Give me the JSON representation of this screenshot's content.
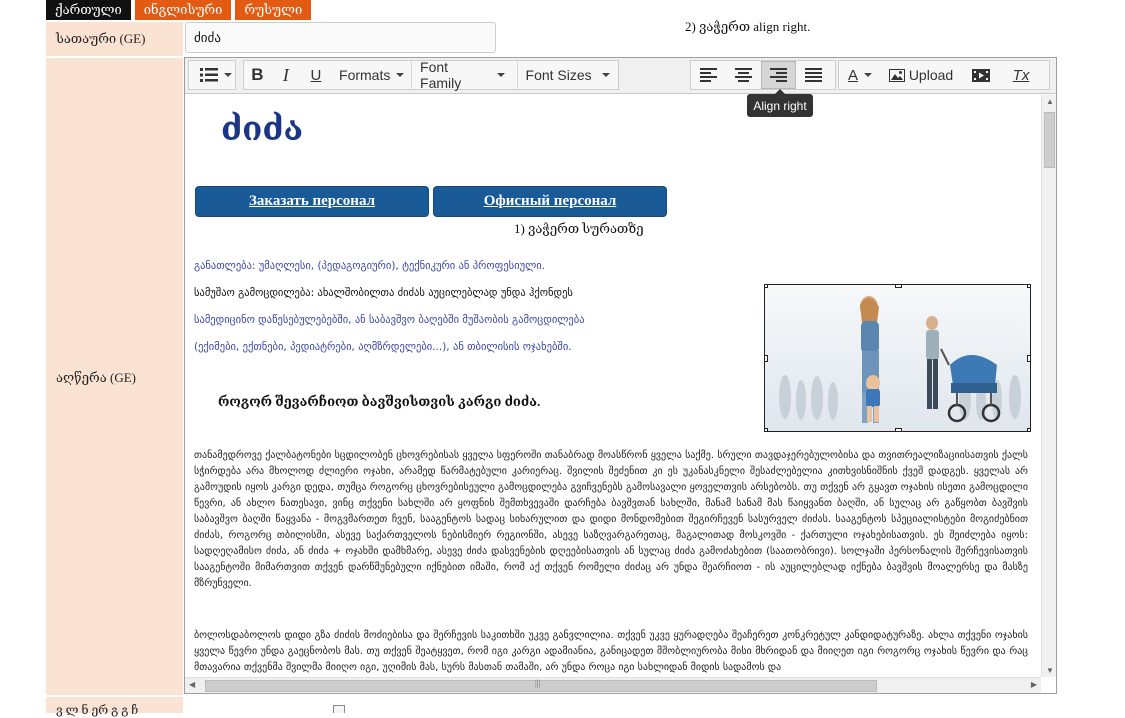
{
  "lang_tabs": [
    {
      "label": "ქართული"
    },
    {
      "label": "ინგლისური"
    },
    {
      "label": "რუსული"
    }
  ],
  "top_note": "2) ვაჭერთ align right.",
  "form": {
    "title_label": "სათაური (GE)",
    "title_value": "ძიძა",
    "description_label": "აღწერა (GE)",
    "bottom_label": "ვ ლ ნ ერ გ გ ჩ"
  },
  "toolbar": {
    "formats": "Formats",
    "font_family": "Font Family",
    "font_sizes": "Font Sizes",
    "upload": "Upload",
    "bold_glyph": "B",
    "italic_glyph": "I",
    "underline_glyph": "U",
    "color_glyph": "A",
    "clear_glyph": "Tx",
    "tooltip": "Align right"
  },
  "content": {
    "logo": "ძიძა",
    "button_order": "Заказать персонал",
    "button_office": "Офисный персонал",
    "image_note": "1) ვაჭერთ სურათზე",
    "requirements": [
      {
        "text": "განათლება: უმაღლესი, (პედაგოგიური), ტექნიკური ან პროფესიული.",
        "color": "blue"
      },
      {
        "text": "სამუშაო გამოცდილება: ახალშობილთა ძიძას აუცილებლად უნდა ჰქონდეს",
        "color": "black"
      },
      {
        "text": "სამედიცინო დაწესებულებებში, ან საბავშვო ბაღებში მუშაობის გამოცდილება",
        "color": "blue"
      },
      {
        "text": "(ექიმები, ექთნები, პედიატრები, აღმზრდელები...), ან თბილისის ოჯახებში.",
        "color": "blue"
      }
    ],
    "subheading": "როგორ შევარჩიოთ ბავშვისთვის კარგი ძიძა.",
    "paragraph1": "თანამედროვე ქალბატონები სცდილობენ ცხოვრებისას ყველა სფეროში თანაბრად მოასწრონ ყველა საქმე. სრული თავდაჯერებულობისა და თვითრეალიზაციისათვის ქალს სჭირდება არა მხოლოდ ძლიერი ოჯახი, არამედ წარმატებული კარიერაც. შვილის შეძენით კი ეს უკანასკნელი შესაძლებელია კითხვისნიშნის ქვეშ დადგეს. ყველას არ გამოუდის იყოს კარგი დედა, თუმცა როგორც ცხოვრებისეული გამოცდილება გვიჩვენებს გამოსავალი ყოველთვის არსებობს. თუ თქვენ არ გყავთ ოჯახის ისეთი გამოცდილი წევრი, ან ახლო ნათესავი, ვინც თქვენი სახლში არ ყოფნის შემთხვევაში დარჩება ბავშვთან სახლში, მანამ სანამ მას წაიყვანთ ბაღში, ან სულაც არ გაწყობთ ბავშვის საბავშვო ბაღში წაყვანა - მოგვმართეთ ჩვენ, სააგენტოს სადაც სიხარულით და დიდი მონდომებით შეგირჩევენ სასურველ ძიძას. სააგენტოს სპეციალისტები მოგიძებნით ძიძას, როგორც თბილისში, ასევე საქართველოს ნებისმიერ რეგიონში, ასევე საზღვარგარეთაც, მაგალითად მოსკოვში - ქართული ოჯახებისათვის. ეს შეიძლება იყოს: სადღეღამისო ძიძა, ან ძიძა + ოჯახში დამხმარე, ასევე ძიძა დასვენების დღეებისათვის ან სულაც ძიძა გამოძახებით (საათობრივი). სოლჯაში პერსონალის შერჩევისათვის სააგენტოში მიმართვით თქვენ დარწმუნებული იქნებით იმაში, რომ აქ თქვენ რომელი ძიძაც არ უნდა შეარჩიოთ - ის აუცილებლად იქნება ბავშვის მოალერსე და მასზე მზრუნველი.",
    "paragraph2": "ბოლოსდაბოლოს დიდი გზა ძიძის მოძიებისა და შერჩევის საკითხში უკვე განვლილია. თქვენ უკვე ყურადღება შეაჩერეთ კონკრეტულ კანდიდატურაზე. ახლა თქვენი ოჯახის ყველა წევრი უნდა გაეცნობოს მას. თუ თქვენ შეატყვეთ, რომ იგი კარგი ადამიანია, განიცადეთ მშობლიურობა მისი მხრიდან და მიიღეთ იგი როგორც ოჯახის წევრი და რაც მთავარია თქვენმა შვილმა მიიღო იგი, უღიმის მას, სურს მასთან თამაში, არ უნდა როცა იგი სახლიდან მიდის სადამოს და"
  },
  "colors": {
    "tab_active": "#111111",
    "tab_inactive": "#e35b13",
    "label_bg": "#fbe3d4",
    "button_blue": "#1a5a96",
    "logo_blue": "#1b3686"
  },
  "icons": [
    "list-icon",
    "bold-icon",
    "italic-icon",
    "underline-icon",
    "align-left-icon",
    "align-center-icon",
    "align-right-icon",
    "align-justify-icon",
    "text-color-icon",
    "image-icon",
    "media-icon",
    "clear-format-icon"
  ]
}
